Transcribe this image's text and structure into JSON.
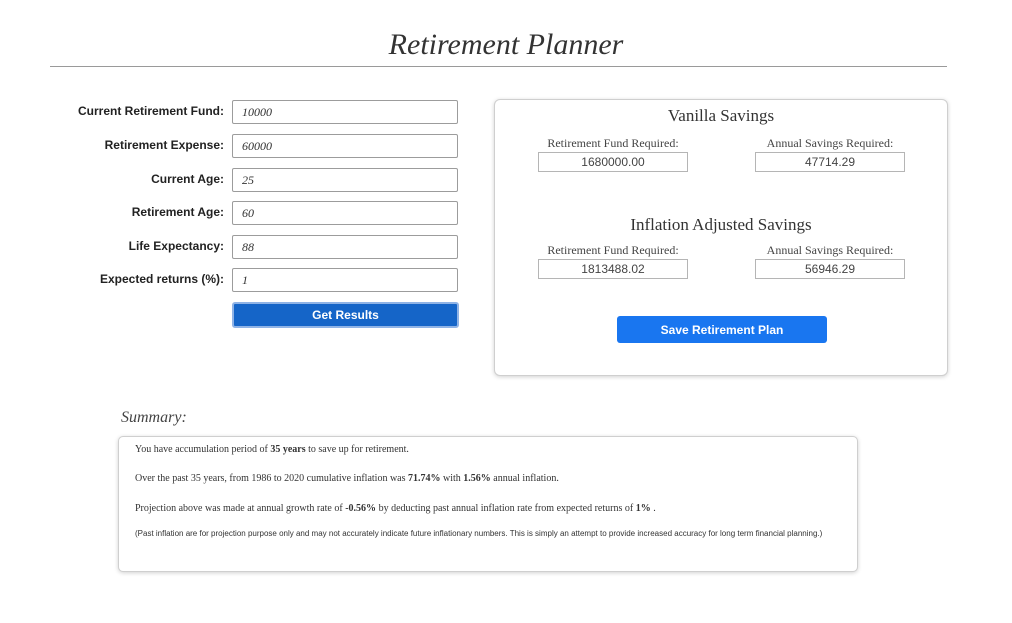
{
  "page": {
    "title": "Retirement Planner"
  },
  "form": {
    "fields": [
      {
        "label": "Current Retirement Fund:",
        "value": "10000"
      },
      {
        "label": "Retirement Expense:",
        "value": "60000"
      },
      {
        "label": "Current Age:",
        "value": "25"
      },
      {
        "label": "Retirement Age:",
        "value": "60"
      },
      {
        "label": "Life Expectancy:",
        "value": "88"
      },
      {
        "label": "Expected returns (%):",
        "value": "1"
      }
    ],
    "submit_label": "Get Results"
  },
  "results": {
    "vanilla": {
      "heading": "Vanilla Savings",
      "fund_label": "Retirement Fund Required:",
      "fund_value": "1680000.00",
      "savings_label": "Annual Savings Required:",
      "savings_value": "47714.29"
    },
    "inflation": {
      "heading": "Inflation Adjusted Savings",
      "fund_label": "Retirement Fund Required:",
      "fund_value": "1813488.02",
      "savings_label": "Annual Savings Required:",
      "savings_value": "56946.29"
    },
    "save_label": "Save Retirement Plan"
  },
  "summary": {
    "title": "Summary:",
    "l1": {
      "a": "You have accumulation period of ",
      "b": "35 years",
      "c": " to save up for retirement."
    },
    "l2": {
      "a": "Over the past 35 years, from 1986 to 2020 cumulative inflation was ",
      "b": "71.74%",
      "c": " with ",
      "d": "1.56%",
      "e": " annual inflation."
    },
    "l3": {
      "a": "Projection above was made at annual growth rate of ",
      "b": "-0.56%",
      "c": " by deducting past annual inflation rate from expected returns of ",
      "d": "1%",
      "e": " ."
    },
    "note": "(Past inflation are for projection purpose only and may not accurately indicate future inflationary numbers. This is simply an attempt to provide increased accuracy for long term financial planning.)"
  },
  "colors": {
    "primary": "#1565c8",
    "save_button": "#1976f0"
  }
}
